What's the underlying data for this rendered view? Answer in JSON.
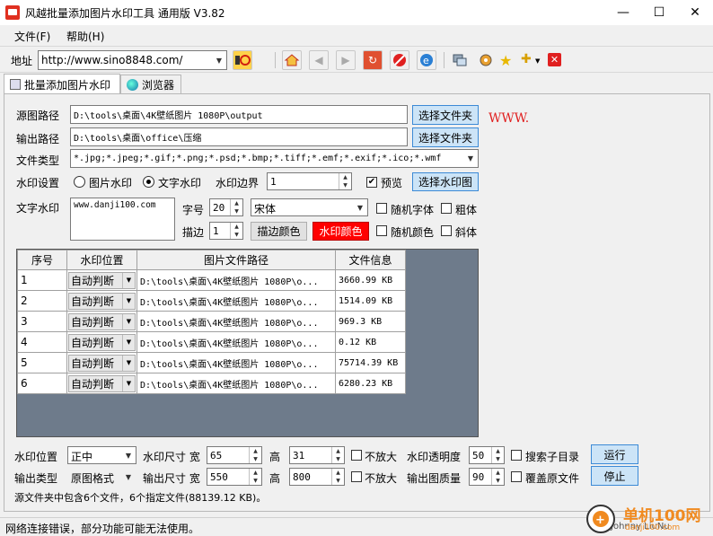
{
  "window": {
    "title": "风越批量添加图片水印工具 通用版 V3.82",
    "minimize": "—",
    "maximize": "☐",
    "close": "✕"
  },
  "menu": [
    "文件(F)",
    "帮助(H)"
  ],
  "toolbar": {
    "address_label": "地址",
    "address_value": "http://www.sino8848.com/",
    "icons": [
      "go-icon",
      "home-icon",
      "back-icon",
      "forward-icon",
      "refresh-icon",
      "stop-icon",
      "ie-icon",
      "window-icon",
      "settings-icon",
      "favorite-icon",
      "add-favorite-icon",
      "close-red-icon"
    ]
  },
  "tabs": [
    {
      "label": "批量添加图片水印"
    },
    {
      "label": "浏览器"
    }
  ],
  "form": {
    "source_label": "源图路径",
    "source_value": "D:\\tools\\桌面\\4K壁纸图片 1080P\\output",
    "source_btn": "选择文件夹",
    "side_text": "WWW.",
    "output_label": "输出路径",
    "output_value": "D:\\tools\\桌面\\office\\压缩",
    "output_btn": "选择文件夹",
    "filetype_label": "文件类型",
    "filetype_value": "*.jpg;*.jpeg;*.gif;*.png;*.psd;*.bmp;*.tiff;*.emf;*.exif;*.ico;*.wmf",
    "wm_setting_label": "水印设置",
    "radio_image": "图片水印",
    "radio_text": "文字水印",
    "wm_border_label": "水印边界",
    "wm_border_value": "1",
    "preview_label": "预览",
    "choose_wm_image_btn": "选择水印图",
    "text_wm_label": "文字水印",
    "text_wm_value": "www.danji100.com",
    "fontsize_label": "字号",
    "fontsize_value": "20",
    "font_value": "宋体",
    "random_font_label": "随机字体",
    "bold_label": "粗体",
    "stroke_label": "描边",
    "stroke_value": "1",
    "stroke_color_btn": "描边颜色",
    "wm_color_btn": "水印颜色",
    "random_color_label": "随机颜色",
    "italic_label": "斜体"
  },
  "grid": {
    "columns": [
      "序号",
      "水印位置",
      "图片文件路径",
      "文件信息"
    ],
    "rows": [
      {
        "no": "1",
        "pos": "自动判断",
        "path": "D:\\tools\\桌面\\4K壁纸图片 1080P\\o...",
        "info": "3660.99 KB"
      },
      {
        "no": "2",
        "pos": "自动判断",
        "path": "D:\\tools\\桌面\\4K壁纸图片 1080P\\o...",
        "info": "1514.09 KB"
      },
      {
        "no": "3",
        "pos": "自动判断",
        "path": "D:\\tools\\桌面\\4K壁纸图片 1080P\\o...",
        "info": "969.3 KB"
      },
      {
        "no": "4",
        "pos": "自动判断",
        "path": "D:\\tools\\桌面\\4K壁纸图片 1080P\\o...",
        "info": "0.12 KB"
      },
      {
        "no": "5",
        "pos": "自动判断",
        "path": "D:\\tools\\桌面\\4K壁纸图片 1080P\\o...",
        "info": "75714.39 KB"
      },
      {
        "no": "6",
        "pos": "自动判断",
        "path": "D:\\tools\\桌面\\4K壁纸图片 1080P\\o...",
        "info": "6280.23 KB"
      }
    ]
  },
  "bottom": {
    "wm_pos_label": "水印位置",
    "wm_pos_value": "正中",
    "wm_size_label": "水印尺寸 宽",
    "wm_width": "65",
    "wm_height_label": "高",
    "wm_height": "31",
    "no_enlarge1": "不放大",
    "opacity_label": "水印透明度",
    "opacity_value": "50",
    "search_sub_label": "搜索子目录",
    "run_btn": "运行",
    "out_type_label": "输出类型",
    "out_type_value": "原图格式",
    "out_size_label": "输出尺寸 宽",
    "out_width": "550",
    "out_height_label": "高",
    "out_height": "800",
    "no_enlarge2": "不放大",
    "quality_label": "输出图质量",
    "quality_value": "90",
    "overwrite_label": "覆盖原文件",
    "stop_btn": "停止",
    "summary": "源文件夹中包含6个文件，6个指定文件(88139.12 KB)。"
  },
  "status": {
    "text": "网络连接错误，部分功能可能无法使用。",
    "right_text": "Johnny LiuNu",
    "logo_text": "单机100网",
    "logo_sub": "danji100.com"
  },
  "colors": {
    "accent_blue": "#3c8ad6",
    "grid_bg": "#6e7b8b",
    "wm_color": "#ff0000"
  }
}
